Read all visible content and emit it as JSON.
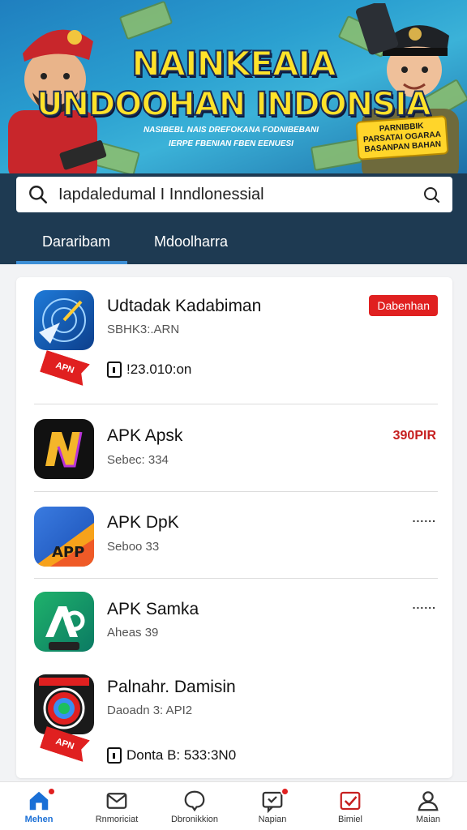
{
  "banner": {
    "title_line1": "NAINKEAIA",
    "title_line2": "UNDOOHAN INDONSIA",
    "subtitle_line1": "NASIBEBL NAIS DREFOKANA FODNIBEBANI",
    "subtitle_line2": "IERPE FBENIAN FBEN EENUESI",
    "badge_line1": "PARNIBBIK",
    "badge_line2": "PARSATAI OGARAA",
    "badge_line3": "BASANPAN BAHAN"
  },
  "search": {
    "query": "Iapdaledumal I Inndlonessial"
  },
  "tabs": [
    {
      "label": "Dararibam"
    },
    {
      "label": "Mdoolharra"
    }
  ],
  "apps": [
    {
      "name": "Udtadak Kadabiman",
      "sub": "SBHK3:.ARN",
      "meta": "!23.010:on",
      "badge": "Dabenhan",
      "ribbon": "APN"
    },
    {
      "name": "APK Apsk",
      "sub": "Sebec: 334",
      "price": "390PIR"
    },
    {
      "name": "APK DpK",
      "sub": "Seboo 33",
      "dots": "......"
    },
    {
      "name": "APK Samka",
      "sub": "Aheas 39",
      "dots": "......"
    },
    {
      "name": "Palnahr. Damisin",
      "sub": "Daoadn 3: API2",
      "meta": "Donta B: 533:3N0",
      "ribbon": "APN"
    }
  ],
  "icon_labels": {
    "app3_tag": "APP",
    "app1_ribbon": "APN"
  },
  "nav": [
    {
      "label": "Mehen",
      "icon": "home-icon",
      "active": true
    },
    {
      "label": "Rnmoriciat",
      "icon": "mail-icon"
    },
    {
      "label": "Dbronikkion",
      "icon": "chat-icon"
    },
    {
      "label": "Napian",
      "icon": "notification-icon"
    },
    {
      "label": "Bimiel",
      "icon": "checkbox-icon"
    },
    {
      "label": "Maian",
      "icon": "user-icon"
    }
  ],
  "colors": {
    "accent": "#1a6fd6",
    "dark_band": "#1e3a52",
    "red": "#e02020",
    "title_yellow": "#ffe22a"
  }
}
